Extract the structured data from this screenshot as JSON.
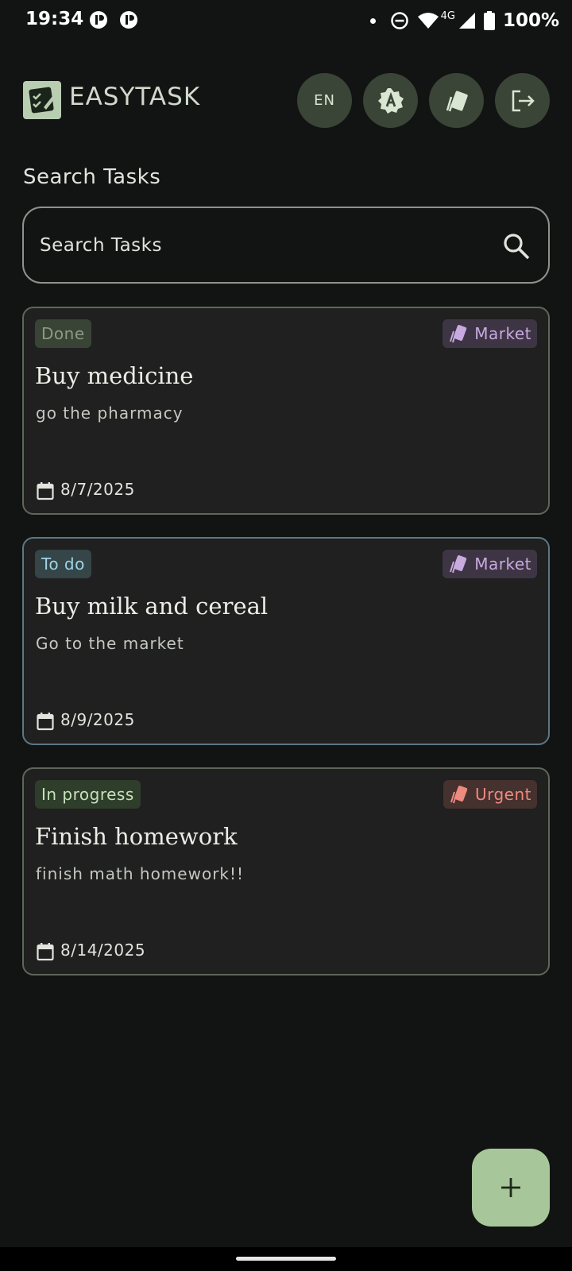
{
  "status_bar": {
    "time": "19:34",
    "network_type": "4G",
    "battery": "100%"
  },
  "header": {
    "app_name": "EASYTASK",
    "language_button_label": "EN",
    "buttons": [
      "brightness-auto-icon",
      "tags-icon",
      "logout-icon"
    ]
  },
  "search": {
    "heading": "Search Tasks",
    "placeholder": "Search Tasks"
  },
  "tasks": [
    {
      "status": "Done",
      "tag": "Market",
      "title": "Buy medicine",
      "description": "go the pharmacy",
      "date": "8/7/2025"
    },
    {
      "status": "To do",
      "tag": "Market",
      "title": "Buy milk and cereal",
      "description": "Go to the market",
      "date": "8/9/2025"
    },
    {
      "status": "In progress",
      "tag": "Urgent",
      "title": "Finish homework",
      "description": "finish math homework!!",
      "date": "8/14/2025"
    }
  ],
  "colors": {
    "background": "#111412",
    "card": "#1f201f",
    "accent": "#a7c79b",
    "header_button": "#3a4437",
    "market_tag": "#c8a9e0",
    "urgent_tag": "#ee8a80"
  },
  "fab": {
    "icon": "plus-icon"
  }
}
